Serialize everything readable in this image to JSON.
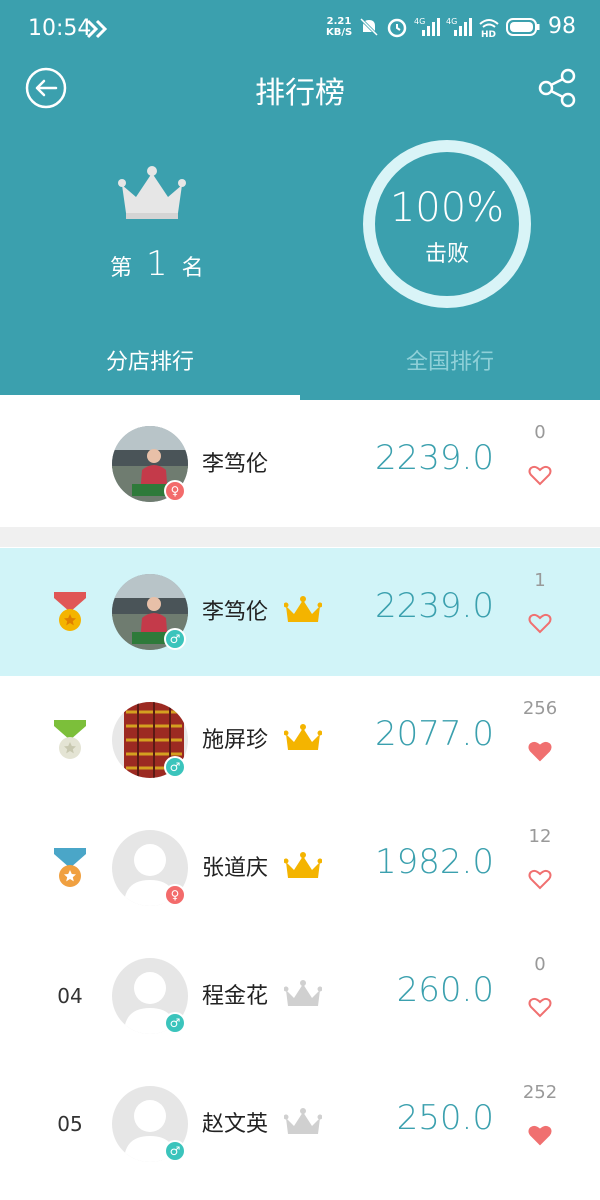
{
  "statusbar": {
    "time": "10:54",
    "net_speed_value": "2.21",
    "net_speed_unit": "KB/S",
    "sim1": "4G",
    "sim2": "4G",
    "hd": "HD",
    "battery": "98"
  },
  "header": {
    "title": "排行榜",
    "rank_prefix": "第",
    "rank_number": "1",
    "rank_suffix": "名",
    "beat_percent": "100%",
    "beat_label": "击败"
  },
  "tabs": [
    {
      "label": "分店排行",
      "active": true
    },
    {
      "label": "全国排行",
      "active": false
    }
  ],
  "colors": {
    "primary": "#3ba0ae",
    "highlight": "#d1f4f8",
    "heart": "#f07070",
    "gold": "#f4b400",
    "silver": "#d0d0d0",
    "female": "#f36b6b",
    "male": "#3bc4bc"
  },
  "my_entry": {
    "name": "李笃伦",
    "score": "2239.0",
    "likes": "0",
    "liked": false,
    "gender": "female",
    "avatar": "photo-person"
  },
  "ranking": [
    {
      "rank": "",
      "medal": "gold-medal-icon",
      "name": "李笃伦",
      "crown": "gold",
      "score": "2239.0",
      "likes": "1",
      "liked": false,
      "gender": "male",
      "avatar": "photo-person",
      "highlight": true
    },
    {
      "rank": "",
      "medal": "silver-medal-icon",
      "name": "施屏珍",
      "crown": "gold",
      "score": "2077.0",
      "likes": "256",
      "liked": true,
      "gender": "male",
      "avatar": "photo-curtain",
      "highlight": false
    },
    {
      "rank": "",
      "medal": "bronze-medal-icon",
      "name": "张道庆",
      "crown": "gold",
      "score": "1982.0",
      "likes": "12",
      "liked": false,
      "gender": "female",
      "avatar": "default-avatar",
      "highlight": false
    },
    {
      "rank": "04",
      "medal": "",
      "name": "程金花",
      "crown": "silver",
      "score": "260.0",
      "likes": "0",
      "liked": false,
      "gender": "male",
      "avatar": "default-avatar",
      "highlight": false
    },
    {
      "rank": "05",
      "medal": "",
      "name": "赵文英",
      "crown": "silver",
      "score": "250.0",
      "likes": "252",
      "liked": true,
      "gender": "male",
      "avatar": "default-avatar",
      "highlight": false
    }
  ]
}
